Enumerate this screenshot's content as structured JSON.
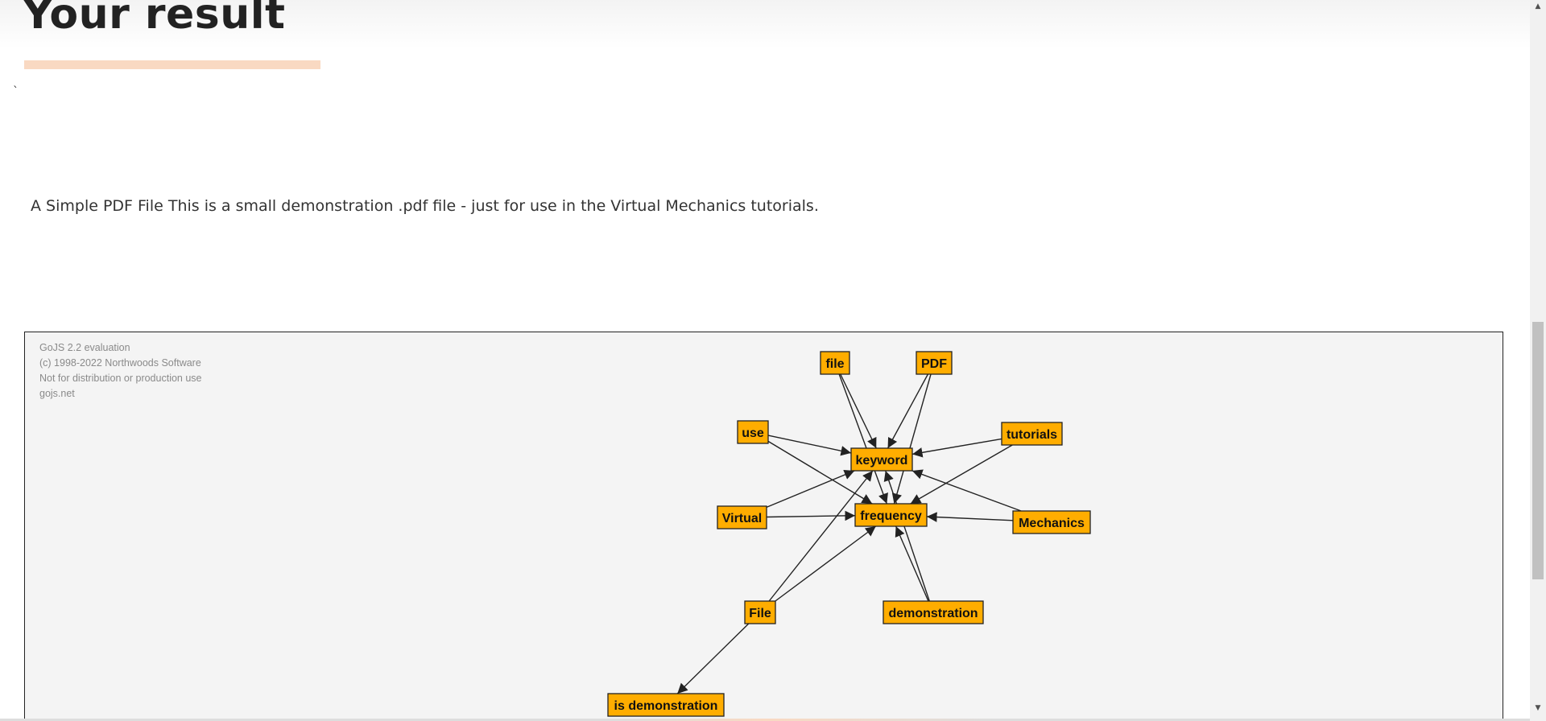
{
  "page": {
    "title": "Your result",
    "stray_mark": "`",
    "result_text": "A Simple PDF File This is a small demonstration .pdf file - just for use in the Virtual Mechanics tutorials."
  },
  "diagram": {
    "watermark": [
      "GoJS 2.2 evaluation",
      "(c) 1998-2022 Northwoods Software",
      "Not for distribution or production use",
      "gojs.net"
    ],
    "node_color": "#ffad00",
    "nodes": [
      {
        "id": "file",
        "label": "file"
      },
      {
        "id": "PDF",
        "label": "PDF"
      },
      {
        "id": "use",
        "label": "use"
      },
      {
        "id": "tutorials",
        "label": "tutorials"
      },
      {
        "id": "keyword",
        "label": "keyword"
      },
      {
        "id": "Virtual",
        "label": "Virtual"
      },
      {
        "id": "frequency",
        "label": "frequency"
      },
      {
        "id": "Mechanics",
        "label": "Mechanics"
      },
      {
        "id": "File",
        "label": "File"
      },
      {
        "id": "demonstration",
        "label": "demonstration"
      },
      {
        "id": "is_demonstration",
        "label": "is demonstration"
      }
    ],
    "edges": [
      {
        "from": "file",
        "to": "keyword"
      },
      {
        "from": "file",
        "to": "frequency"
      },
      {
        "from": "PDF",
        "to": "keyword"
      },
      {
        "from": "PDF",
        "to": "frequency"
      },
      {
        "from": "use",
        "to": "keyword"
      },
      {
        "from": "use",
        "to": "frequency"
      },
      {
        "from": "tutorials",
        "to": "keyword"
      },
      {
        "from": "tutorials",
        "to": "frequency"
      },
      {
        "from": "Virtual",
        "to": "keyword"
      },
      {
        "from": "Virtual",
        "to": "frequency"
      },
      {
        "from": "Mechanics",
        "to": "keyword"
      },
      {
        "from": "Mechanics",
        "to": "frequency"
      },
      {
        "from": "File",
        "to": "keyword"
      },
      {
        "from": "File",
        "to": "frequency"
      },
      {
        "from": "demonstration",
        "to": "keyword"
      },
      {
        "from": "demonstration",
        "to": "frequency"
      },
      {
        "from": "File",
        "to": "is_demonstration"
      }
    ]
  },
  "scrollbar": {
    "up_arrow": "▲",
    "down_arrow": "▼"
  }
}
